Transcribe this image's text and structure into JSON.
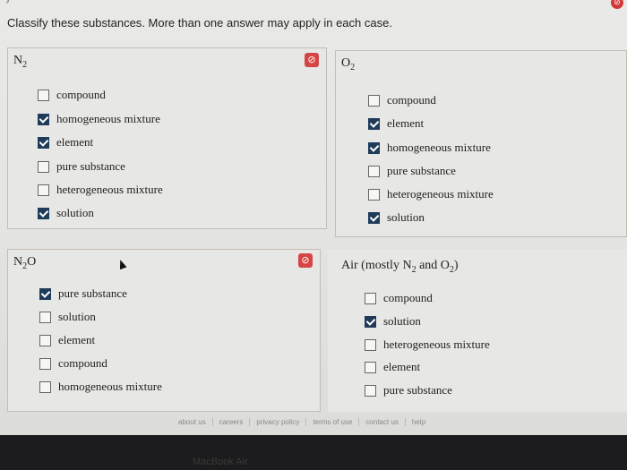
{
  "header": {
    "nav_arrow": "›",
    "instructions": "Classify these substances. More than one answer may apply in each case."
  },
  "panels": [
    {
      "title": "N",
      "sub": "2",
      "title_after": "",
      "sub2": "",
      "title_end": "",
      "has_clear": true,
      "options": [
        {
          "label": "compound",
          "checked": false
        },
        {
          "label": "homogeneous mixture",
          "checked": true
        },
        {
          "label": "element",
          "checked": true
        },
        {
          "label": "pure substance",
          "checked": false
        },
        {
          "label": "heterogeneous mixture",
          "checked": false
        },
        {
          "label": "solution",
          "checked": true
        }
      ]
    },
    {
      "title": "O",
      "sub": "2",
      "title_after": "",
      "sub2": "",
      "title_end": "",
      "has_clear": false,
      "options": [
        {
          "label": "compound",
          "checked": false
        },
        {
          "label": "element",
          "checked": true
        },
        {
          "label": "homogeneous mixture",
          "checked": true
        },
        {
          "label": "pure substance",
          "checked": false
        },
        {
          "label": "heterogeneous mixture",
          "checked": false
        },
        {
          "label": "solution",
          "checked": true
        }
      ]
    },
    {
      "title": "N",
      "sub": "2",
      "title_after": "O",
      "sub2": "",
      "title_end": "",
      "has_clear": true,
      "options": [
        {
          "label": "pure substance",
          "checked": true
        },
        {
          "label": "solution",
          "checked": false
        },
        {
          "label": "element",
          "checked": false
        },
        {
          "label": "compound",
          "checked": false
        },
        {
          "label": "homogeneous mixture",
          "checked": false
        }
      ]
    },
    {
      "title": "Air (mostly N",
      "sub": "2",
      "title_after": " and O",
      "sub2": "2",
      "title_end": ")",
      "has_clear": false,
      "options": [
        {
          "label": "compound",
          "checked": false
        },
        {
          "label": "solution",
          "checked": true
        },
        {
          "label": "heterogeneous mixture",
          "checked": false
        },
        {
          "label": "element",
          "checked": false
        },
        {
          "label": "pure substance",
          "checked": false
        }
      ]
    }
  ],
  "footer": {
    "links": [
      "about us",
      "careers",
      "privacy policy",
      "terms of use",
      "contact us",
      "help"
    ]
  },
  "bezel": {
    "text": "MacBook Air"
  },
  "colors": {
    "checkbox_checked": "#1f3b5a",
    "clear_button": "#d64545"
  }
}
